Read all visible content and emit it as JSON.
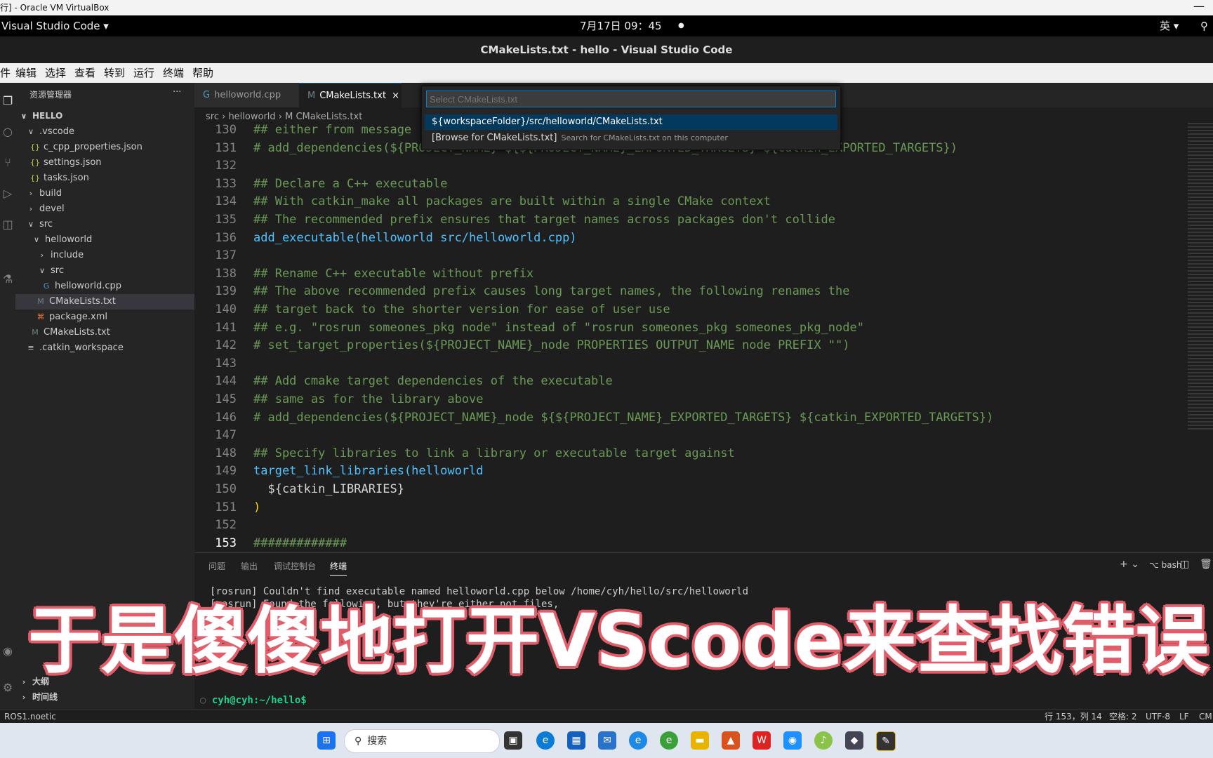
{
  "vbox": {
    "title": "行] - Oracle VM VirtualBox",
    "minimize": "—"
  },
  "gnome": {
    "app_menu": "Visual Studio Code ▾",
    "clock": "7月17日 09：45",
    "clock_dot": "●",
    "ime": "英 ▾",
    "network": "⚲"
  },
  "window_title": "CMakeLists.txt - hello - Visual Studio Code",
  "menu": [
    "件",
    "编辑",
    "选择",
    "查看",
    "转到",
    "运行",
    "终端",
    "帮助"
  ],
  "sidebar": {
    "title": "资源管理器",
    "more": "···",
    "root": "HELLO",
    "items": [
      {
        "label": ".vscode",
        "icon": "∨"
      },
      {
        "label": "c_cpp_properties.json",
        "icon": "{}"
      },
      {
        "label": "settings.json",
        "icon": "{}"
      },
      {
        "label": "tasks.json",
        "icon": "{}"
      },
      {
        "label": "build",
        "icon": "›"
      },
      {
        "label": "devel",
        "icon": "›"
      },
      {
        "label": "src",
        "icon": "∨"
      },
      {
        "label": "helloworld",
        "icon": "∨"
      },
      {
        "label": "include",
        "icon": "›"
      },
      {
        "label": "src",
        "icon": "∨"
      },
      {
        "label": "helloworld.cpp",
        "icon": "G"
      },
      {
        "label": "CMakeLists.txt",
        "icon": "M"
      },
      {
        "label": "package.xml",
        "icon": "⌘"
      },
      {
        "label": "CMakeLists.txt",
        "icon": "M"
      },
      {
        "label": ".catkin_workspace",
        "icon": "≡"
      }
    ],
    "outline": "大纲",
    "timeline": "时间线"
  },
  "tabs": [
    {
      "label": "helloworld.cpp",
      "icon": "G"
    },
    {
      "label": "CMakeLists.txt",
      "icon": "M",
      "close": "×"
    }
  ],
  "breadcrumb": "src › helloworld › M CMakeLists.txt",
  "quickpick": {
    "placeholder": "Select CMakeLists.txt",
    "item1": "${workspaceFolder}/src/helloworld/CMakeLists.txt",
    "item2": "[Browse for CMakeLists.txt]",
    "item2_desc": "Search for CMakeLists.txt on this computer"
  },
  "code": [
    {
      "n": "130",
      "t": "## either from message"
    },
    {
      "n": "131",
      "t": "# add_dependencies(${PROJECT_NAME} ${${PROJECT_NAME}_EXPORTED_TARGETS} ${catkin_EXPORTED_TARGETS})"
    },
    {
      "n": "132",
      "t": ""
    },
    {
      "n": "133",
      "t": "## Declare a C++ executable"
    },
    {
      "n": "134",
      "t": "## With catkin_make all packages are built within a single CMake context"
    },
    {
      "n": "135",
      "t": "## The recommended prefix ensures that target names across packages don't collide"
    },
    {
      "n": "136",
      "t": "add_executable(helloworld src/helloworld.cpp)"
    },
    {
      "n": "137",
      "t": ""
    },
    {
      "n": "138",
      "t": "## Rename C++ executable without prefix"
    },
    {
      "n": "139",
      "t": "## The above recommended prefix causes long target names, the following renames the"
    },
    {
      "n": "140",
      "t": "## target back to the shorter version for ease of user use"
    },
    {
      "n": "141",
      "t": "## e.g. \"rosrun someones_pkg node\" instead of \"rosrun someones_pkg someones_pkg_node\""
    },
    {
      "n": "142",
      "t": "# set_target_properties(${PROJECT_NAME}_node PROPERTIES OUTPUT_NAME node PREFIX \"\")"
    },
    {
      "n": "143",
      "t": ""
    },
    {
      "n": "144",
      "t": "## Add cmake target dependencies of the executable"
    },
    {
      "n": "145",
      "t": "## same as for the library above"
    },
    {
      "n": "146",
      "t": "# add_dependencies(${PROJECT_NAME}_node ${${PROJECT_NAME}_EXPORTED_TARGETS} ${catkin_EXPORTED_TARGETS})"
    },
    {
      "n": "147",
      "t": ""
    },
    {
      "n": "148",
      "t": "## Specify libraries to link a library or executable target against"
    },
    {
      "n": "149",
      "t": "target_link_libraries(helloworld"
    },
    {
      "n": "150",
      "t": "  ${catkin_LIBRARIES}"
    },
    {
      "n": "151",
      "t": ")"
    },
    {
      "n": "152",
      "t": ""
    },
    {
      "n": "153",
      "t": "#############"
    }
  ],
  "panel": {
    "tabs": [
      "问题",
      "输出",
      "调试控制台",
      "终端"
    ],
    "shell": "bash",
    "add": "+ ⌄",
    "terminal": [
      "[rosrun] Couldn't find executable named helloworld.cpp below /home/cyh/hello/src/helloworld",
      "[rosrun] Found the following, but they're either not files,"
    ],
    "prompt": "cyh@cyh:~/hello$"
  },
  "subtitle": "于是傻傻地打开VScode来查找错误",
  "status": {
    "left": "ROS1.noetic",
    "position": "行 153，列 14",
    "spaces": "空格: 2",
    "encoding": "UTF-8",
    "eol": "LF",
    "lang": "CM"
  },
  "taskbar": {
    "search": "搜索"
  }
}
